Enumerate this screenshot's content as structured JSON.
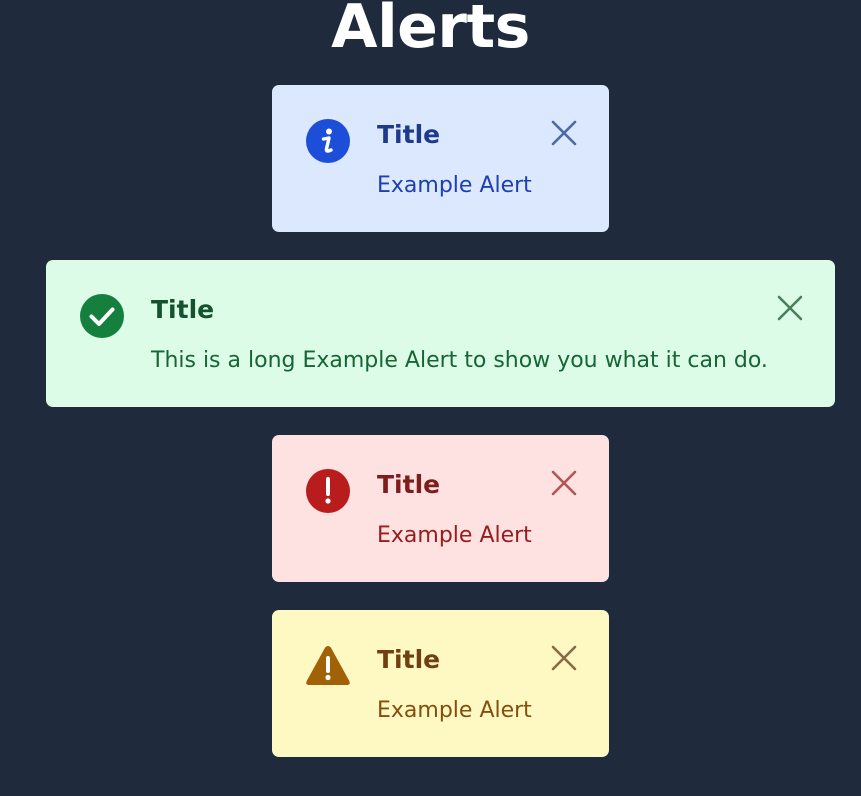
{
  "page": {
    "title": "Alerts",
    "background": "#1f2a3d"
  },
  "alerts": [
    {
      "variant": "info",
      "title": "Title",
      "message": "Example Alert",
      "icon": "info-icon",
      "colors": {
        "background": "#dbe8fe",
        "icon": "#1d4ed8",
        "title": "#1e3a8a",
        "message": "#1e40af",
        "close": "#4b6ba5"
      }
    },
    {
      "variant": "success",
      "title": "Title",
      "message": "This is a long Example Alert to show you what it can do.",
      "icon": "check-circle-icon",
      "colors": {
        "background": "#dcfce7",
        "icon": "#15803d",
        "title": "#14532d",
        "message": "#166534",
        "close": "#4b7f5c"
      }
    },
    {
      "variant": "error",
      "title": "Title",
      "message": "Example Alert",
      "icon": "exclamation-circle-icon",
      "colors": {
        "background": "#fee2e2",
        "icon": "#b91c1c",
        "title": "#7f1d1d",
        "message": "#991b1b",
        "close": "#b25555"
      }
    },
    {
      "variant": "warning",
      "title": "Title",
      "message": "Example Alert",
      "icon": "warning-triangle-icon",
      "colors": {
        "background": "#fef9c3",
        "icon": "#a16207",
        "title": "#713f12",
        "message": "#854d0e",
        "close": "#8a6a45"
      }
    }
  ]
}
